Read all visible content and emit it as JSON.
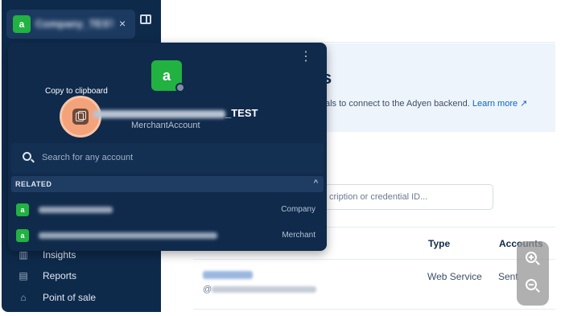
{
  "sidebar": {
    "account_chip": {
      "logo_glyph": "a",
      "name": "Company_TEST",
      "close_glyph": "×"
    },
    "nav_items": [
      {
        "label": "Insights",
        "icon": "bar-chart-icon"
      },
      {
        "label": "Reports",
        "icon": "document-icon"
      },
      {
        "label": "Point of sale",
        "icon": "store-icon"
      }
    ]
  },
  "main": {
    "banner": {
      "title": "s",
      "description": "als to connect to the Adyen backend.",
      "learn_more": "Learn more ↗"
    },
    "search": {
      "placeholder": "cription or credential ID..."
    },
    "table": {
      "columns": [
        "Type",
        "Accounts"
      ],
      "rows": [
        {
          "user": "ws_123456",
          "email": "@",
          "type": "Web Service",
          "accounts": "Sent"
        }
      ]
    }
  },
  "dropdown": {
    "menu_glyph": "⋮",
    "logo_glyph": "a",
    "copy_tooltip": "Copy to clipboard",
    "account_name_suffix": "_TEST",
    "account_type": "MerchantAccount",
    "search_placeholder": "Search for any account",
    "related_label": "RELATED",
    "related_chevron": "^",
    "related": [
      {
        "type": "Company",
        "logo_glyph": "a"
      },
      {
        "type": "Merchant",
        "logo_glyph": "a"
      }
    ]
  },
  "colors": {
    "sidebar_bg": "#0e2a4b",
    "dropdown_bg": "#0f2a4b",
    "brand_green": "#21b241",
    "link_blue": "#0a66c2",
    "copy_highlight": "#f4a27a"
  }
}
